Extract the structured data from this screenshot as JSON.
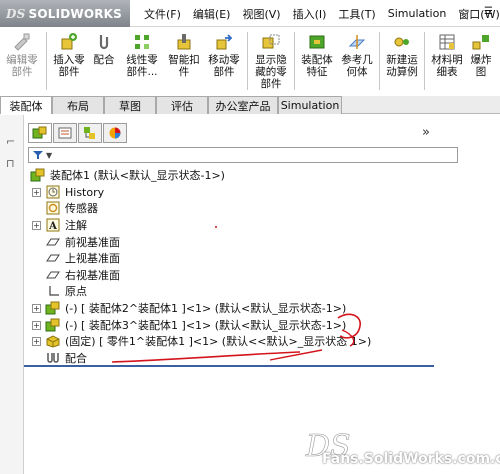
{
  "app": {
    "logo_text": "SOLIDWORKS",
    "logo_mark": "DS"
  },
  "menu": {
    "items": [
      "文件(F)",
      "编辑(E)",
      "视图(V)",
      "插入(I)",
      "工具(T)",
      "Simulation",
      "窗口(W)"
    ],
    "overflow": "☰"
  },
  "toolbar": {
    "buttons": [
      {
        "label": "编辑零\n部件",
        "icon": "edit-part-icon",
        "enabled": false
      },
      {
        "label": "插入零\n部件",
        "icon": "insert-component-icon",
        "enabled": true
      },
      {
        "label": "配合",
        "icon": "mate-icon",
        "enabled": true
      },
      {
        "label": "线性零\n部件...",
        "icon": "linear-pattern-icon",
        "enabled": true
      },
      {
        "label": "智能扣\n件",
        "icon": "smart-fastener-icon",
        "enabled": true
      },
      {
        "label": "移动零\n部件",
        "icon": "move-component-icon",
        "enabled": true
      },
      {
        "label": "显示隐\n藏的零\n部件",
        "icon": "show-hidden-icon",
        "enabled": true
      },
      {
        "label": "装配体\n特征",
        "icon": "assembly-feature-icon",
        "enabled": true
      },
      {
        "label": "参考几\n何体",
        "icon": "reference-geometry-icon",
        "enabled": true
      },
      {
        "label": "新建运\n动算例",
        "icon": "motion-study-icon",
        "enabled": true
      },
      {
        "label": "材料明\n细表",
        "icon": "bom-icon",
        "enabled": true
      },
      {
        "label": "爆炸\n图",
        "icon": "exploded-view-icon",
        "enabled": true
      }
    ]
  },
  "tabs": [
    {
      "label": "装配体",
      "active": true
    },
    {
      "label": "布局",
      "active": false
    },
    {
      "label": "草图",
      "active": false
    },
    {
      "label": "评估",
      "active": false
    },
    {
      "label": "办公室产品",
      "active": false
    },
    {
      "label": "Simulation",
      "active": false
    }
  ],
  "panel": {
    "expand_glyph": "»",
    "filter_glyph": "▼"
  },
  "tree": {
    "root": "装配体1 (默认<默认_显示状态-1>)",
    "items": [
      {
        "label": "History",
        "icon": "history-icon",
        "expandable": true
      },
      {
        "label": "传感器",
        "icon": "sensor-icon",
        "expandable": false
      },
      {
        "label": "注解",
        "icon": "annotation-icon",
        "expandable": true
      },
      {
        "label": "前视基准面",
        "icon": "plane-icon",
        "expandable": false
      },
      {
        "label": "上视基准面",
        "icon": "plane-icon",
        "expandable": false
      },
      {
        "label": "右视基准面",
        "icon": "plane-icon",
        "expandable": false
      },
      {
        "label": "原点",
        "icon": "origin-icon",
        "expandable": false
      },
      {
        "label": "(-) [ 装配体2^装配体1 ]<1> (默认<默认_显示状态-1>)",
        "icon": "subassembly-icon",
        "expandable": true
      },
      {
        "label": "(-) [ 装配体3^装配体1 ]<1> (默认<默认_显示状态-1>)",
        "icon": "subassembly-icon",
        "expandable": true
      },
      {
        "label": "(固定) [ 零件1^装配体1 ]<1> (默认<<默认>_显示状态 1>)",
        "icon": "part-icon",
        "expandable": true
      },
      {
        "label": "配合",
        "icon": "mates-folder-icon",
        "expandable": false
      }
    ]
  },
  "watermark": {
    "text": "Fans.SolidWorks.com.cn"
  },
  "colors": {
    "assembly_green": "#6fb31f",
    "part_yellow": "#e3c22a",
    "annotation_red": "#d4141c",
    "tree_line": "#3a5fa0"
  }
}
